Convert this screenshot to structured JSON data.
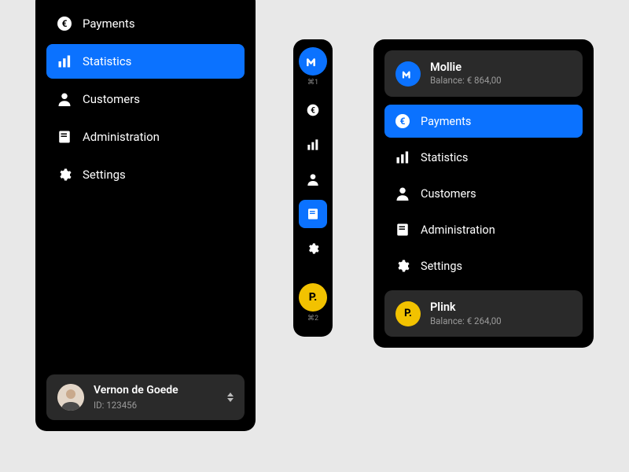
{
  "colors": {
    "accent": "#0b72ff",
    "plink": "#f2c200"
  },
  "left": {
    "items": [
      {
        "label": "Payments",
        "icon": "euro",
        "active": false
      },
      {
        "label": "Statistics",
        "icon": "bars",
        "active": true
      },
      {
        "label": "Customers",
        "icon": "person",
        "active": false
      },
      {
        "label": "Administration",
        "icon": "doc",
        "active": false
      },
      {
        "label": "Settings",
        "icon": "gear",
        "active": false
      }
    ],
    "user": {
      "name": "Vernon de Goede",
      "id_label": "ID:",
      "id": "123456"
    }
  },
  "mid": {
    "workspaces": [
      {
        "logo": "mollie",
        "shortcut": "⌘1"
      },
      {
        "logo": "plink",
        "shortcut": "⌘2"
      }
    ],
    "items": [
      {
        "icon": "euro",
        "active": false
      },
      {
        "icon": "bars",
        "active": false
      },
      {
        "icon": "person",
        "active": false
      },
      {
        "icon": "doc",
        "active": true
      },
      {
        "icon": "gear",
        "active": false
      }
    ]
  },
  "right": {
    "accounts": [
      {
        "name": "Mollie",
        "balance_label": "Balance:",
        "balance": "€ 864,00",
        "logo": "mollie"
      },
      {
        "name": "Plink",
        "balance_label": "Balance:",
        "balance": "€ 264,00",
        "logo": "plink"
      }
    ],
    "items": [
      {
        "label": "Payments",
        "icon": "euro",
        "active": true
      },
      {
        "label": "Statistics",
        "icon": "bars",
        "active": false
      },
      {
        "label": "Customers",
        "icon": "person",
        "active": false
      },
      {
        "label": "Administration",
        "icon": "doc",
        "active": false
      },
      {
        "label": "Settings",
        "icon": "gear",
        "active": false
      }
    ]
  }
}
